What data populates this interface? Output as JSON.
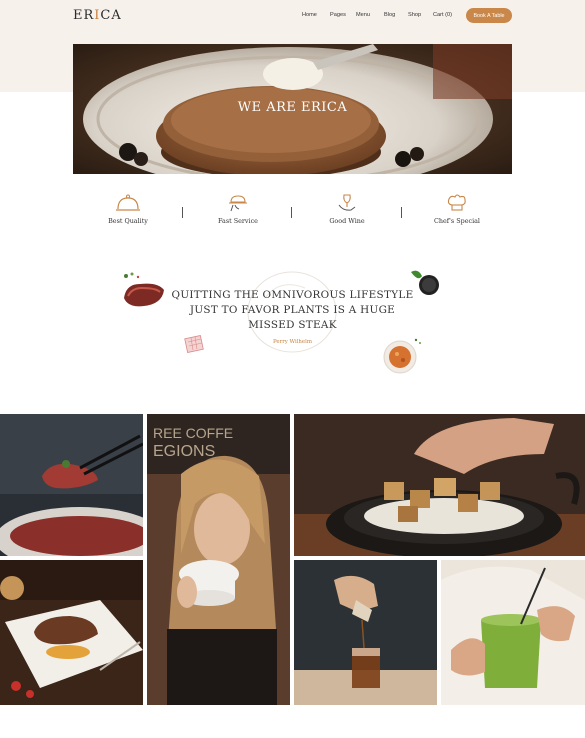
{
  "brand": {
    "logo_text": "ERICA"
  },
  "nav": {
    "items": [
      "Home",
      "Pages",
      "Menu",
      "Blog",
      "Shop",
      "Cart (0)"
    ]
  },
  "header": {
    "cta_label": "Book A Table"
  },
  "hero": {
    "title": "WE ARE ERICA"
  },
  "features": [
    {
      "label": "Best Quality",
      "icon": "cloche-icon"
    },
    {
      "label": "Fast Service",
      "icon": "serving-tray-icon"
    },
    {
      "label": "Good Wine",
      "icon": "wine-glass-icon"
    },
    {
      "label": "Chef's Special",
      "icon": "chef-hat-icon"
    }
  ],
  "testimonial": {
    "quote": "QUITTING THE OMNIVOROUS LIFESTYLE JUST TO FAVOR PLANTS IS A HUGE MISSED STEAK",
    "author": "Perry Wilhelm"
  },
  "colors": {
    "accent": "#c98749",
    "band": "#f7f1ec",
    "text": "#333333"
  },
  "gallery": {
    "photos": [
      "steak-dish-photo",
      "woman-coffee-photo",
      "tofu-pan-photo",
      "plated-steak-photo",
      "cocktail-pour-photo",
      "green-drink-photo"
    ]
  }
}
